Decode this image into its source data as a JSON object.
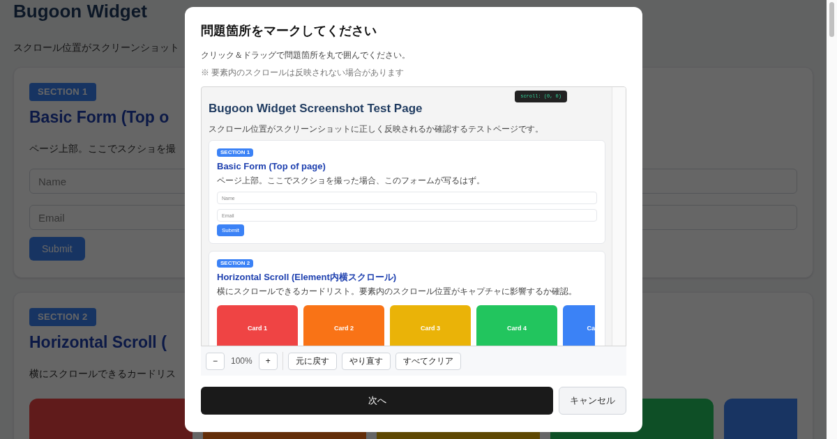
{
  "page": {
    "title": "Bugoon Widget",
    "subtitle": "スクロール位置がスクリーンショット",
    "sections": [
      {
        "badge": "SECTION 1",
        "heading": "Basic Form (Top o",
        "description": "ページ上部。ここでスクショを撮",
        "fields": [
          {
            "placeholder": "Name"
          },
          {
            "placeholder": "Email"
          }
        ],
        "button": "Submit"
      },
      {
        "badge": "SECTION 2",
        "heading": "Horizontal Scroll (",
        "description": "横にスクロールできるカードリス",
        "cards": [
          {
            "color": "#601b1b"
          },
          {
            "color": "#642e09"
          },
          {
            "color": "#5e4803"
          },
          {
            "color": "#0e4f26"
          },
          {
            "color": "#183462"
          }
        ]
      }
    ]
  },
  "dialog": {
    "title": "問題箇所をマークしてください",
    "instruction": "クリック＆ドラッグで問題箇所を丸で囲んでください。",
    "note": "※ 要素内のスクロールは反映されない場合があります",
    "preview": {
      "scroll_badge": "scroll: (0, 0)",
      "title": "Bugoon Widget Screenshot Test Page",
      "subtitle": "スクロール位置がスクリーンショットに正しく反映されるか確認するテストページです。",
      "sections": [
        {
          "badge": "SECTION 1",
          "heading": "Basic Form (Top of page)",
          "description": "ページ上部。ここでスクショを撮った場合、このフォームが写るはず。",
          "fields": [
            {
              "placeholder": "Name"
            },
            {
              "placeholder": "Email"
            }
          ],
          "button": "Submit"
        },
        {
          "badge": "SECTION 2",
          "heading": "Horizontal Scroll (Element内横スクロール)",
          "description": "横にスクロールできるカードリスト。要素内のスクロール位置がキャプチャに影響するか確認。",
          "cards": [
            {
              "label": "Card 1",
              "color": "#ef4444"
            },
            {
              "label": "Card 2",
              "color": "#f97316"
            },
            {
              "label": "Card 3",
              "color": "#eab308"
            },
            {
              "label": "Card 4",
              "color": "#22c55e"
            },
            {
              "label": "Ca",
              "color": "#3b82f6"
            }
          ]
        }
      ]
    },
    "toolbar": {
      "zoom_out": "−",
      "zoom": "100%",
      "zoom_in": "+",
      "actions": [
        "元に戻す",
        "やり直す",
        "すべてクリア"
      ]
    },
    "next_button": "次へ",
    "cancel_button": "キャンセル"
  }
}
